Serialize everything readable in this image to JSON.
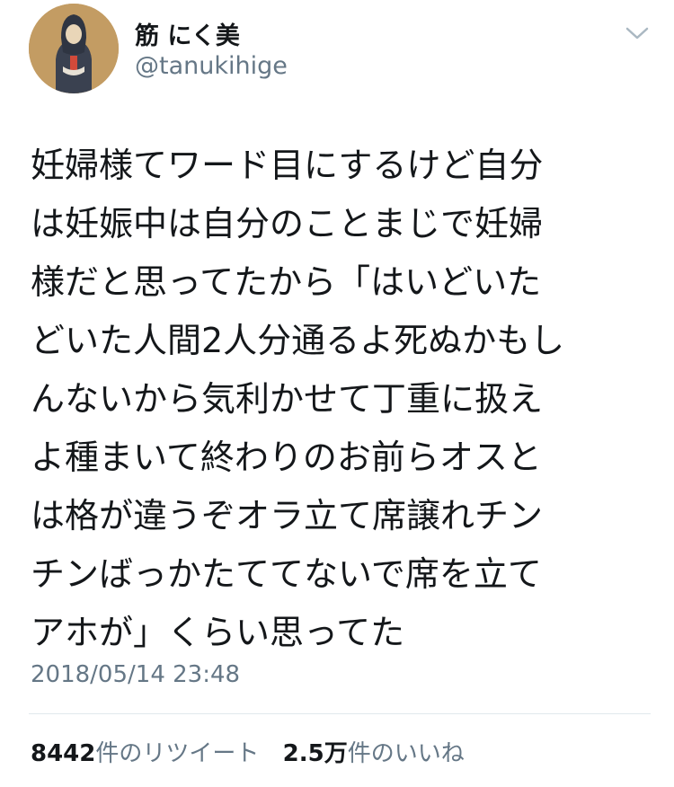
{
  "user": {
    "display_name": "筋 にく美",
    "handle": "@tanukihige"
  },
  "tweet": {
    "lines": [
      "妊婦様てワード目にするけど自分",
      "は妊娠中は自分のことまじで妊婦",
      "様だと思ってたから「はいどいた",
      "どいた人間2人分通るよ死ぬかもし",
      "んないから気利かせて丁重に扱え",
      "よ種まいて終わりのお前らオスと",
      "は格が違うぞオラ立て席譲れチン",
      "チンばっかたててないで席を立て",
      "アホが」くらい思ってた"
    ],
    "timestamp": "2018/05/14 23:48"
  },
  "stats": {
    "retweets": {
      "count": "8442",
      "label": "件のリツイート"
    },
    "likes": {
      "count": "2.5万",
      "label": "件のいいね"
    }
  },
  "icons": {
    "menu": "chevron-down-icon",
    "avatar": "avatar-image"
  },
  "colors": {
    "text": "#14171a",
    "secondary": "#657786",
    "divider": "#e1e8ed"
  }
}
